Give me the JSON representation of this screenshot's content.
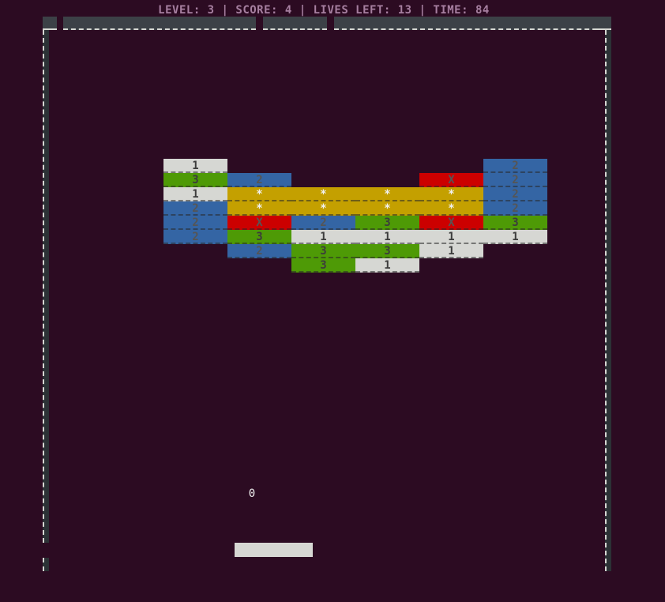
{
  "status_bar": {
    "text": "LEVEL: 3 | SCORE: 4 | LIVES LEFT: 13 | TIME: 84"
  },
  "colors": {
    "background": "#2c0b22",
    "wall": "#3c4147",
    "wall_dash": "#d6d7d3",
    "status_text": "#a67fa0",
    "paddle": "#d6d7d3",
    "brick_white": "#d6d7d3",
    "brick_green": "#4e9a06",
    "brick_blue": "#3465a4",
    "brick_red": "#cc0000",
    "brick_yellow": "#c4a000"
  },
  "ball": {
    "symbol": "0"
  },
  "bricks": [
    {
      "col": 0,
      "row": 0,
      "label": "1",
      "kind": "white"
    },
    {
      "col": 5,
      "row": 0,
      "label": "2",
      "kind": "blue"
    },
    {
      "col": 0,
      "row": 1,
      "label": "3",
      "kind": "green"
    },
    {
      "col": 1,
      "row": 1,
      "label": "2",
      "kind": "blue"
    },
    {
      "col": 4,
      "row": 1,
      "label": "X",
      "kind": "red"
    },
    {
      "col": 5,
      "row": 1,
      "label": "2",
      "kind": "blue"
    },
    {
      "col": 0,
      "row": 2,
      "label": "1",
      "kind": "white"
    },
    {
      "col": 1,
      "row": 2,
      "label": "*",
      "kind": "yellow"
    },
    {
      "col": 2,
      "row": 2,
      "label": "*",
      "kind": "yellow"
    },
    {
      "col": 3,
      "row": 2,
      "label": "*",
      "kind": "yellow"
    },
    {
      "col": 4,
      "row": 2,
      "label": "*",
      "kind": "yellow"
    },
    {
      "col": 5,
      "row": 2,
      "label": "2",
      "kind": "blue"
    },
    {
      "col": 0,
      "row": 3,
      "label": "2",
      "kind": "blue"
    },
    {
      "col": 1,
      "row": 3,
      "label": "*",
      "kind": "yellow"
    },
    {
      "col": 2,
      "row": 3,
      "label": "*",
      "kind": "yellow"
    },
    {
      "col": 3,
      "row": 3,
      "label": "*",
      "kind": "yellow"
    },
    {
      "col": 4,
      "row": 3,
      "label": "*",
      "kind": "yellow"
    },
    {
      "col": 5,
      "row": 3,
      "label": "2",
      "kind": "blue"
    },
    {
      "col": 0,
      "row": 4,
      "label": "2",
      "kind": "blue"
    },
    {
      "col": 1,
      "row": 4,
      "label": "X",
      "kind": "red"
    },
    {
      "col": 2,
      "row": 4,
      "label": "2",
      "kind": "blue"
    },
    {
      "col": 3,
      "row": 4,
      "label": "3",
      "kind": "green"
    },
    {
      "col": 4,
      "row": 4,
      "label": "X",
      "kind": "red"
    },
    {
      "col": 5,
      "row": 4,
      "label": "3",
      "kind": "green"
    },
    {
      "col": 0,
      "row": 5,
      "label": "2",
      "kind": "blue"
    },
    {
      "col": 1,
      "row": 5,
      "label": "3",
      "kind": "green"
    },
    {
      "col": 2,
      "row": 5,
      "label": "1",
      "kind": "white"
    },
    {
      "col": 3,
      "row": 5,
      "label": "1",
      "kind": "white"
    },
    {
      "col": 4,
      "row": 5,
      "label": "1",
      "kind": "white"
    },
    {
      "col": 5,
      "row": 5,
      "label": "1",
      "kind": "white"
    },
    {
      "col": 1,
      "row": 6,
      "label": "2",
      "kind": "blue"
    },
    {
      "col": 2,
      "row": 6,
      "label": "3",
      "kind": "green"
    },
    {
      "col": 3,
      "row": 6,
      "label": "3",
      "kind": "green"
    },
    {
      "col": 4,
      "row": 6,
      "label": "1",
      "kind": "white"
    },
    {
      "col": 2,
      "row": 7,
      "label": "3",
      "kind": "green"
    },
    {
      "col": 3,
      "row": 7,
      "label": "1",
      "kind": "white"
    }
  ]
}
